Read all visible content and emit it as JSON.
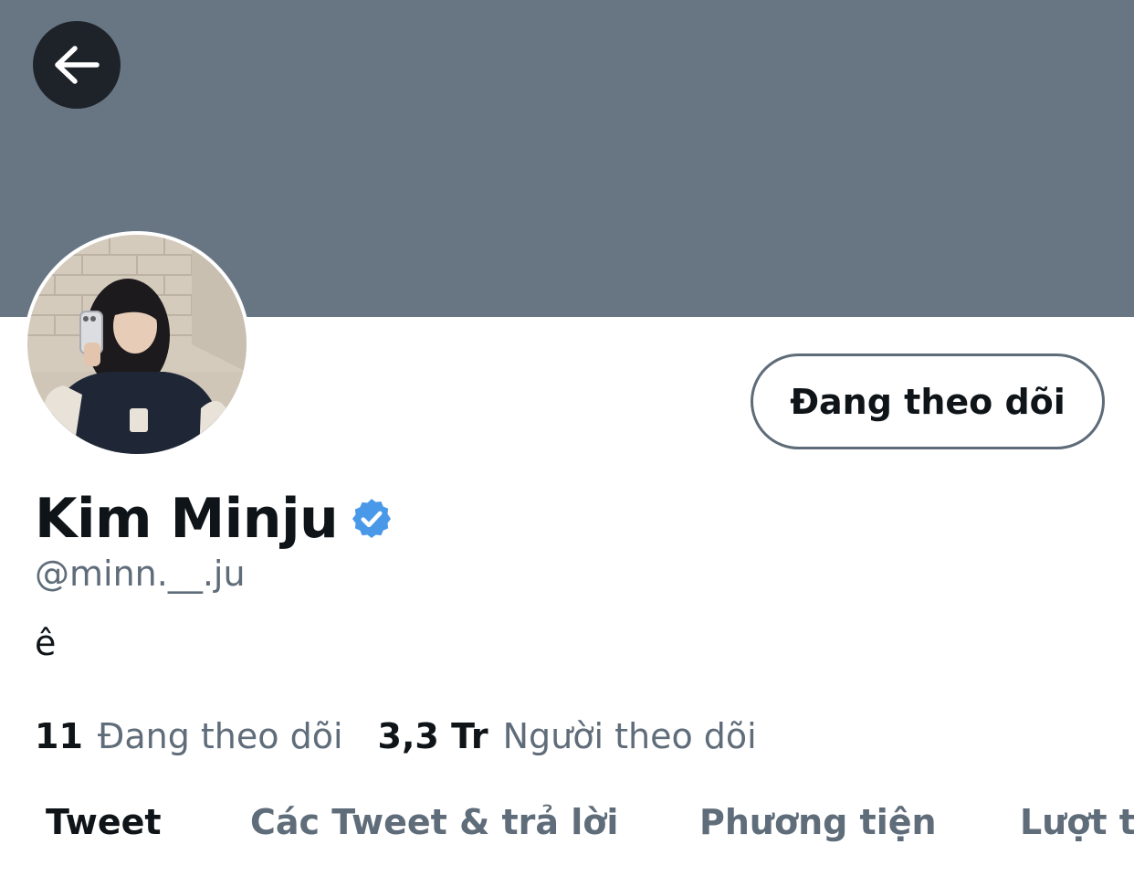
{
  "header": {
    "back_icon": "arrow-left-icon",
    "banner_color": "#687684"
  },
  "profile": {
    "display_name": "Kim Minju",
    "verified_icon": "verified-badge-icon",
    "verified_color": "#4a99e9",
    "handle": "@minn.__.ju",
    "bio": "ê",
    "follow_button_label": "Đang theo dõi"
  },
  "stats": {
    "following_count": "11",
    "following_label": "Đang theo dõi",
    "followers_count": "3,3 Tr",
    "followers_label": "Người theo dõi"
  },
  "tabs": [
    {
      "label": "Tweet",
      "active": true
    },
    {
      "label": "Các Tweet & trả lời",
      "active": false
    },
    {
      "label": "Phương tiện",
      "active": false
    },
    {
      "label": "Lượt thích",
      "active": false
    }
  ],
  "colors": {
    "text_primary": "#0f1419",
    "text_secondary": "#5f6c79",
    "accent": "#4a99e9"
  }
}
